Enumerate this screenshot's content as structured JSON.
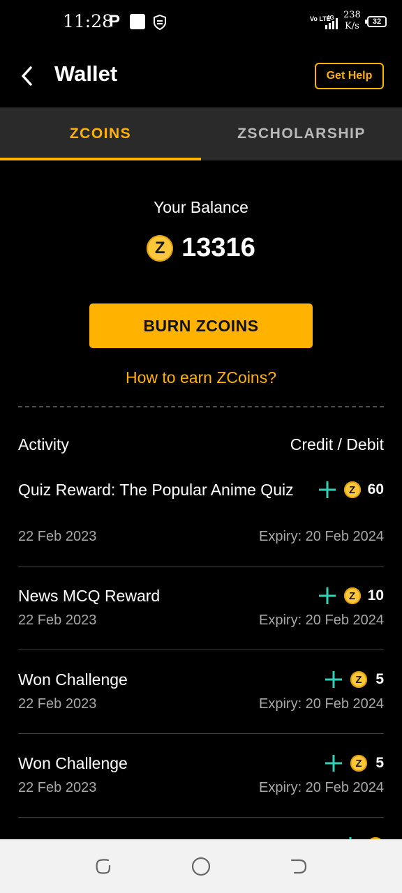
{
  "status_bar": {
    "time": "11:28",
    "network_type": "Vo LTE",
    "network_gen": "4G",
    "speed_value": "238",
    "speed_unit": "K/s",
    "battery": "32"
  },
  "header": {
    "title": "Wallet",
    "help_label": "Get Help"
  },
  "tabs": [
    {
      "label": "ZCOINS",
      "active": true
    },
    {
      "label": "ZSCHOLARSHIP",
      "active": false
    }
  ],
  "balance": {
    "label": "Your Balance",
    "value": "13316",
    "coin_symbol": "Z"
  },
  "actions": {
    "burn_label": "BURN ZCOINS",
    "earn_link": "How to earn ZCoins?"
  },
  "activity": {
    "header_left": "Activity",
    "header_right": "Credit / Debit",
    "items": [
      {
        "title": "Quiz Reward: The Popular Anime Quiz",
        "date": "22 Feb 2023",
        "expiry": "Expiry: 20 Feb 2024",
        "amount": "60"
      },
      {
        "title": "News MCQ Reward",
        "date": "22 Feb 2023",
        "expiry": "Expiry: 20 Feb 2024",
        "amount": "10"
      },
      {
        "title": "Won Challenge",
        "date": "22 Feb 2023",
        "expiry": "Expiry: 20 Feb 2024",
        "amount": "5"
      },
      {
        "title": "Won Challenge",
        "date": "22 Feb 2023",
        "expiry": "Expiry: 20 Feb 2024",
        "amount": "5"
      }
    ]
  },
  "colors": {
    "accent": "#ffb300",
    "credit": "#2ed3b7",
    "background": "#000000"
  },
  "icons": {
    "back": "back-arrow-icon",
    "coin": "zcoin-icon",
    "credit": "plus-icon",
    "nav_recent": "recent-apps-icon",
    "nav_home": "home-icon",
    "nav_back": "back-icon"
  }
}
